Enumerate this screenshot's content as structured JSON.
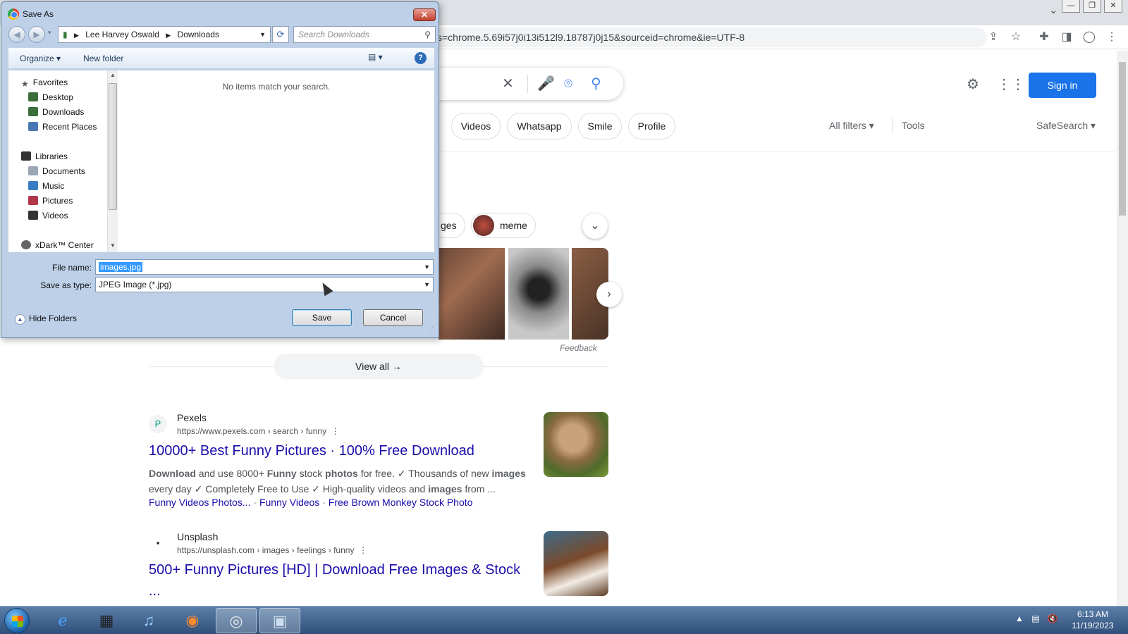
{
  "browser": {
    "url": "s=chrome.5.69i57j0i13i512l9.18787j0j15&sourceid=chrome&ie=UTF-8",
    "window_controls": [
      "—",
      "❐",
      "✕"
    ]
  },
  "google": {
    "sign_in_label": "Sign in",
    "chips": [
      "Videos",
      "Whatsapp",
      "Smile",
      "Profile"
    ],
    "all_filters_label": "All filters",
    "tools_label": "Tools",
    "safesearch_label": "SafeSearch",
    "image_chips": [
      "ges",
      "meme"
    ],
    "feedback_label": "Feedback",
    "view_all_label": "View all",
    "results": [
      {
        "site": "Pexels",
        "url": "https://www.pexels.com › search › funny",
        "title": "10000+ Best Funny Pictures · 100% Free Download",
        "snippet_line1_parts": [
          "Download",
          " and use 8000+ ",
          "Funny",
          " stock ",
          "photos",
          " for free. ✓ Thousands of new ",
          "images"
        ],
        "snippet_line2_parts": [
          "every day ✓ Completely Free to Use ✓ High-quality videos and ",
          "images",
          " from ..."
        ],
        "links": [
          "Funny Videos Photos...",
          "Funny Videos",
          "Free Brown Monkey Stock Photo"
        ]
      },
      {
        "site": "Unsplash",
        "url": "https://unsplash.com › images › feelings › funny",
        "title": "500+ Funny Pictures [HD] | Download Free Images & Stock",
        "title_cont": "..."
      }
    ]
  },
  "dialog": {
    "title": "Save As",
    "breadcrumb": [
      "Lee Harvey Oswald",
      "Downloads"
    ],
    "search_placeholder": "Search Downloads",
    "organize_label": "Organize",
    "new_folder_label": "New folder",
    "nav": {
      "favorites": "Favorites",
      "desktop": "Desktop",
      "downloads": "Downloads",
      "recent": "Recent Places",
      "libraries": "Libraries",
      "documents": "Documents",
      "music": "Music",
      "pictures": "Pictures",
      "videos": "Videos",
      "xdark": "xDark™ Center"
    },
    "empty_message": "No items match your search.",
    "file_name_label": "File name:",
    "file_name_value": "images.jpg",
    "save_type_label": "Save as type:",
    "save_type_value": "JPEG Image (*.jpg)",
    "hide_folders_label": "Hide Folders",
    "save_label": "Save",
    "cancel_label": "Cancel"
  },
  "taskbar": {
    "time": "6:13 AM",
    "date": "11/19/2023"
  },
  "colors": {
    "google_blue": "#1a73e8",
    "link_blue": "#1a0dab",
    "dialog_frame": "#bdd0e8",
    "taskbar": "#2f4f7a"
  }
}
